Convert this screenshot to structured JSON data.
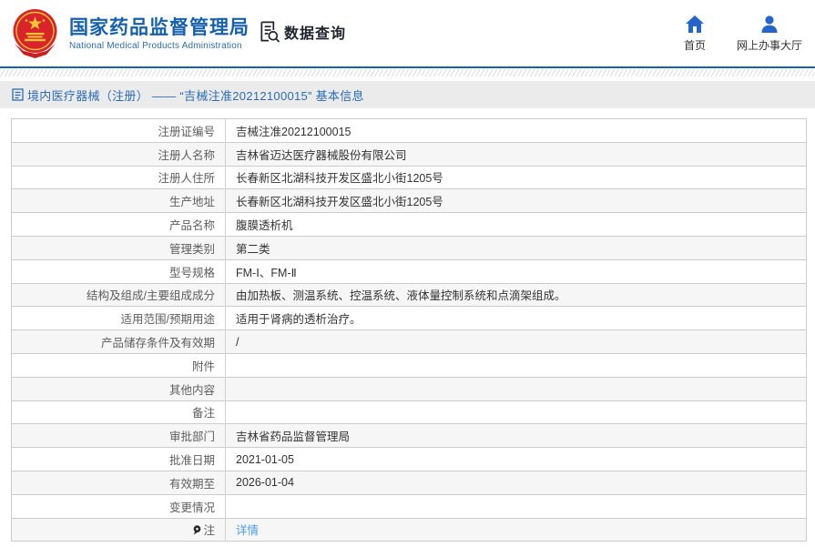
{
  "header": {
    "agency_title": "国家药品监督管理局",
    "agency_subtitle": "National Medical Products Administration",
    "section_label": "数据查询",
    "nav": {
      "home": "首页",
      "service_hall": "网上办事大厅"
    }
  },
  "breadcrumb": "境内医疗器械（注册） —— “吉械注准20212100015” 基本信息",
  "detail_table": {
    "rows": [
      {
        "label": "注册证编号",
        "value": "吉械注准20212100015"
      },
      {
        "label": "注册人名称",
        "value": "吉林省迈达医疗器械股份有限公司"
      },
      {
        "label": "注册人住所",
        "value": "长春新区北湖科技开发区盛北小街1205号"
      },
      {
        "label": "生产地址",
        "value": "长春新区北湖科技开发区盛北小街1205号"
      },
      {
        "label": "产品名称",
        "value": "腹膜透析机"
      },
      {
        "label": "管理类别",
        "value": "第二类"
      },
      {
        "label": "型号规格",
        "value": "FM-Ⅰ、FM-Ⅱ"
      },
      {
        "label": "结构及组成/主要组成成分",
        "value": "由加热板、测温系统、控温系统、液体量控制系统和点滴架组成。"
      },
      {
        "label": "适用范围/预期用途",
        "value": "适用于肾病的透析治疗。"
      },
      {
        "label": "产品储存条件及有效期",
        "value": "/"
      },
      {
        "label": "附件",
        "value": ""
      },
      {
        "label": "其他内容",
        "value": ""
      },
      {
        "label": "备注",
        "value": ""
      },
      {
        "label": "审批部门",
        "value": "吉林省药品监督管理局"
      },
      {
        "label": "批准日期",
        "value": "2021-01-05"
      },
      {
        "label": "有效期至",
        "value": "2026-01-04"
      },
      {
        "label": "变更情况",
        "value": ""
      },
      {
        "label": "注",
        "value": "详情",
        "label_icon": "note-icon",
        "link": true
      }
    ]
  },
  "colors": {
    "brand_blue": "#1661ad",
    "divider_blue": "#1763a8",
    "nav_icon_blue": "#2565c8",
    "breadcrumb_blue": "#2a6db5",
    "link_blue": "#4a9bea",
    "band_gray": "#ebebeb",
    "row_alt_gray": "#f6f6f6",
    "border_gray": "#cccccc",
    "emblem_red": "#d8242a",
    "emblem_gold": "#f5c431"
  }
}
